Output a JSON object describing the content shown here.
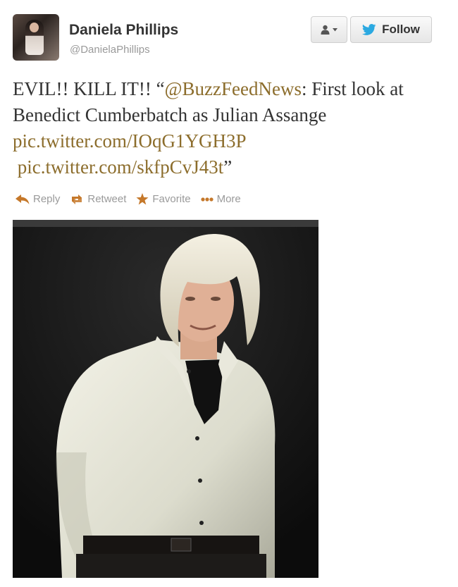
{
  "user": {
    "name": "Daniela Phillips",
    "handle": "@DanielaPhillips"
  },
  "header": {
    "follow_label": "Follow",
    "user_menu_icon": "person-icon"
  },
  "tweet": {
    "lead": "EVIL!! KILL IT!! “",
    "mention": "@BuzzFeedNews",
    "body": ": First look at Benedict Cumberbatch as Julian Assange ",
    "link1": "pic.twitter.com/IOqG1YGH3P",
    "link2": "pic.twitter.com/skfpCvJ43t",
    "close_quote": "”"
  },
  "actions": [
    {
      "label": "Reply",
      "icon": "reply-icon"
    },
    {
      "label": "Retweet",
      "icon": "retweet-icon"
    },
    {
      "label": "Favorite",
      "icon": "star-icon"
    },
    {
      "label": "More",
      "icon": "more-dots-icon"
    }
  ],
  "colors": {
    "link": "#8c6d2c",
    "twitter_blue": "#2ba9e1",
    "action_orange": "#c5782a"
  }
}
